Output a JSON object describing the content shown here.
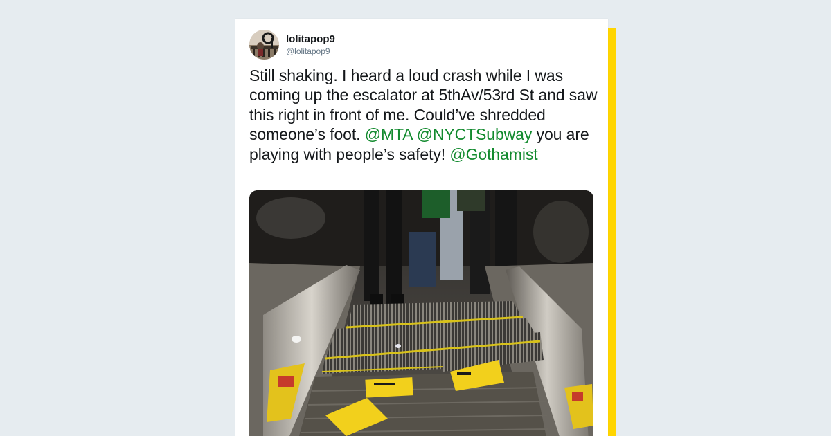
{
  "tweet": {
    "display_name": "lolitapop9",
    "handle": "@lolitapop9",
    "text_segments": [
      {
        "text": "Still shaking. I heard a loud crash while I was coming up the escalator at 5thAv/53rd St and saw this right in front of me. Could’ve shredded someone’s foot. ",
        "type": "plain"
      },
      {
        "text": "@MTA",
        "type": "mention"
      },
      {
        "text": " ",
        "type": "plain"
      },
      {
        "text": "@NYCTSubway",
        "type": "mention"
      },
      {
        "text": " you are playing with people’s safety! ",
        "type": "plain"
      },
      {
        "text": "@Gothamist",
        "type": "mention"
      }
    ],
    "avatar_icon": "avatar-photo",
    "media_icon": "escalator-photo"
  },
  "colors": {
    "accent": "#ffd500",
    "mention": "#128a2e",
    "background": "#e6ecf0"
  }
}
